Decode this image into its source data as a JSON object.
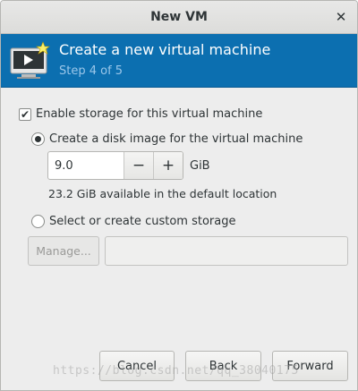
{
  "window": {
    "title": "New VM",
    "close_glyph": "✕"
  },
  "banner": {
    "icon": "vm-display-icon",
    "heading": "Create a new virtual machine",
    "step": "Step 4 of 5",
    "bg_color": "#0c6fb0"
  },
  "storage": {
    "enable_label": "Enable storage for this virtual machine",
    "enable_checked": true,
    "create_disk_label": "Create a disk image for the virtual machine",
    "create_disk_selected": true,
    "size_value": "9.0",
    "minus_glyph": "−",
    "plus_glyph": "+",
    "unit": "GiB",
    "available": "23.2 GiB available in the default location",
    "custom_label": "Select or create custom storage",
    "custom_selected": false,
    "manage_label": "Manage...",
    "custom_path": ""
  },
  "footer": {
    "cancel_label": "Cancel",
    "back_label": "Back",
    "forward_label": "Forward"
  },
  "watermark": "https://blog.csdn.net/qq_38040175"
}
